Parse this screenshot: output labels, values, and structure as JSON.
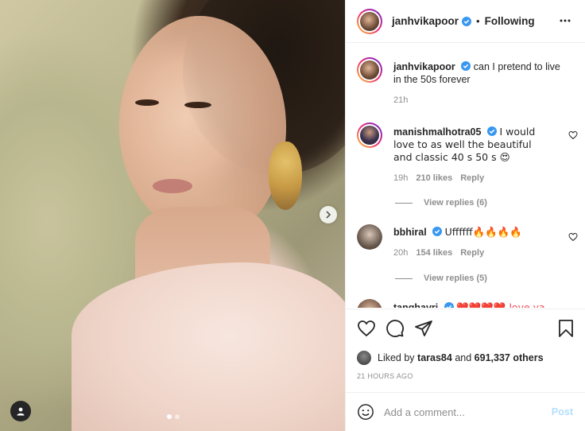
{
  "post": {
    "author": "janhvikapoor",
    "separator": "•",
    "follow_status": "Following"
  },
  "caption": {
    "username": "janhvikapoor",
    "text": "can I pretend to live in the 50s forever",
    "time": "21h"
  },
  "comments": [
    {
      "username": "manishmalhotra05",
      "text": "I would love to as well the beautiful and classic 40 s 50 s 😍",
      "time": "19h",
      "likes": "210 likes",
      "reply": "Reply",
      "view_replies": "View replies (6)"
    },
    {
      "username": "bbhiral",
      "text": "Uffffff🔥🔥🔥🔥",
      "time": "20h",
      "likes": "154 likes",
      "reply": "Reply",
      "view_replies": "View replies (5)"
    },
    {
      "username": "tanghavri",
      "text": "❤️❤️❤️❤️ love ya"
    }
  ],
  "likes": {
    "prefix": "Liked by",
    "user": "taras84",
    "and": "and",
    "count": "691,337 others"
  },
  "timestamp": "21 HOURS AGO",
  "add_comment": {
    "placeholder": "Add a comment...",
    "post_label": "Post"
  },
  "carousel": {
    "total": 2,
    "active": 0
  },
  "icons": {
    "more": "more-options-icon",
    "like": "heart-icon",
    "comment": "comment-icon",
    "share": "share-icon",
    "save": "bookmark-icon",
    "emoji": "emoji-icon",
    "next": "chevron-right-icon",
    "user_tag": "user-tag-icon",
    "verified": "verified-badge-icon"
  },
  "colors": {
    "verified": "#3897f0",
    "post_disabled": "#b2dffc",
    "muted": "#8e8e8e",
    "text": "#262626"
  }
}
